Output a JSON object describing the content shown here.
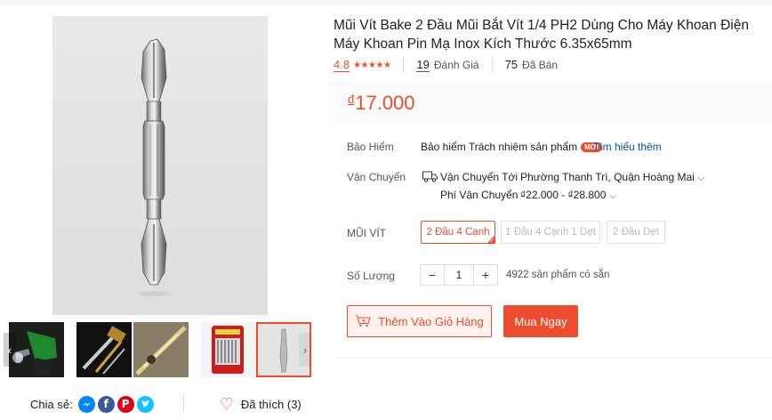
{
  "product": {
    "title": "Mũi Vít Bake 2 Đầu Mũi Bắt Vít 1/4 PH2 Dùng Cho Máy Khoan Điện Máy Khoan Pin Mạ Inox Kích Thước 6.35x65mm",
    "rating": "4.8",
    "stars": "★★★★★",
    "reviews_count": "19",
    "reviews_label": "Đánh Giá",
    "sold_count": "75",
    "sold_label": "Đã Bán",
    "currency_symbol": "đ",
    "price": "17.000"
  },
  "insurance": {
    "label": "Bảo Hiểm",
    "text": "Bảo hiểm Trách nhiệm sản phẩm",
    "badge": "MỚI",
    "link": "Tìm hiểu thêm"
  },
  "shipping": {
    "label": "Vận Chuyển",
    "to_label": "Vận Chuyển Tới",
    "location": "Phường Thanh Trì, Quận Hoàng Mai",
    "fee_label": "Phí Vận Chuyển",
    "fee": "₫22.000 - ₫28.800"
  },
  "variation": {
    "label": "MŨI VÍT",
    "options": [
      "2 Đầu 4 Cạnh",
      "1 Đầu 4 Cạnh 1 Dẹt",
      "2 Đầu Dẹt"
    ],
    "selected": "2 Đầu 4 Cạnh"
  },
  "quantity": {
    "label": "Số Lượng",
    "minus": "−",
    "value": "1",
    "plus": "+",
    "stock": "4922 sản phẩm có sẵn"
  },
  "actions": {
    "add_to_cart": "Thêm Vào Giỏ Hàng",
    "buy_now": "Mua Ngay"
  },
  "share": {
    "label": "Chia sẻ:",
    "icons": [
      "messenger-icon",
      "facebook-icon",
      "pinterest-icon",
      "twitter-icon"
    ]
  },
  "like": {
    "label": "Đã thích (3)"
  },
  "colors": {
    "accent": "#ee4d2d",
    "link": "#0055aa",
    "messenger": "#0084ff",
    "facebook": "#3b5999",
    "pinterest": "#de0217",
    "twitter": "#10c2ff"
  }
}
